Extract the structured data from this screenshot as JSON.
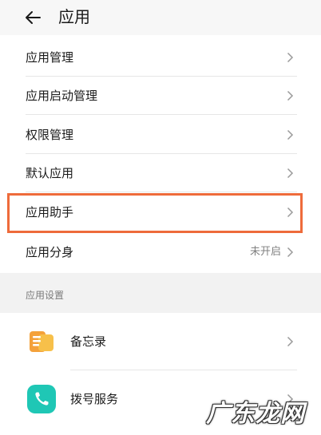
{
  "header": {
    "title": "应用",
    "back_icon": "arrow-left-icon"
  },
  "menu": [
    {
      "label": "应用管理",
      "status": ""
    },
    {
      "label": "应用启动管理",
      "status": ""
    },
    {
      "label": "权限管理",
      "status": ""
    },
    {
      "label": "默认应用",
      "status": ""
    },
    {
      "label": "应用助手",
      "status": ""
    },
    {
      "label": "应用分身",
      "status": "未开启"
    }
  ],
  "section": {
    "title": "应用设置"
  },
  "apps": [
    {
      "label": "备忘录",
      "icon": "notepad-icon",
      "color": "#f4a13a"
    },
    {
      "label": "拨号服务",
      "icon": "phone-icon",
      "color": "#1fc7b5"
    }
  ],
  "watermark": "广东龙网",
  "colors": {
    "highlight": "#ee6b3b",
    "background": "#f2f2f2"
  }
}
